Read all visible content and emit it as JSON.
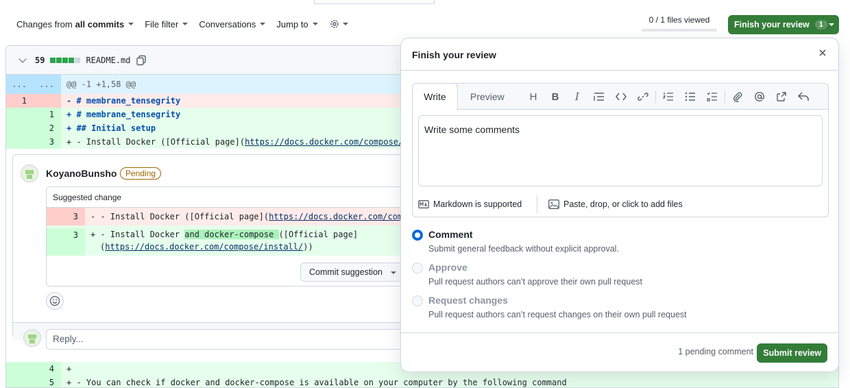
{
  "toolbar": {
    "changes_prefix": "Changes from",
    "changes_value": "all commits",
    "file_filter": "File filter",
    "conversations": "Conversations",
    "jump_to": "Jump to",
    "files_viewed": "0 / 1 files viewed",
    "finish_review": "Finish your review",
    "finish_count": "1"
  },
  "file": {
    "additions": "59",
    "name": "README.md",
    "hunk_header": "@@ -1 +1,58 @@",
    "hunk_old": "...",
    "hunk_new": "...",
    "lines": [
      {
        "old": "1",
        "new": "",
        "type": "del",
        "text": "- # membrane_tensegrity"
      },
      {
        "old": "",
        "new": "1",
        "type": "add",
        "text": "+ # membrane_tensegrity"
      },
      {
        "old": "",
        "new": "2",
        "type": "add",
        "text": "+ ## Initial setup"
      },
      {
        "old": "",
        "new": "3",
        "type": "add",
        "text_pre": "+ - Install Docker ([Official page](",
        "link": "https://docs.docker.com/compose/"
      }
    ],
    "lines_after": [
      {
        "old": "",
        "new": "4",
        "type": "add",
        "text": "+"
      },
      {
        "old": "",
        "new": "5",
        "type": "add",
        "text": "+ - You can check if docker and docker-compose is available on your computer by the following command"
      }
    ]
  },
  "thread": {
    "author": "KoyanoBunsho",
    "badge": "Pending",
    "suggestion_header": "Suggested change",
    "sugg_del_ln": "3",
    "sugg_del_pre": "- - Install Docker ([Official page](",
    "sugg_del_link": "https://docs.docker.com/compo",
    "sugg_add_ln": "3",
    "sugg_add_pre": "+ - Install Docker ",
    "sugg_add_hl": "and docker-compose ",
    "sugg_add_post": "([Official page]",
    "sugg_add_line2_pre": "(",
    "sugg_add_line2_link": "https://docs.docker.com/compose/install/",
    "sugg_add_line2_post": "))",
    "commit_suggestion": "Commit suggestion",
    "reply_placeholder": "Reply..."
  },
  "popover": {
    "title": "Finish your review",
    "tab_write": "Write",
    "tab_preview": "Preview",
    "comment_text": "Write some comments",
    "markdown_note": "Markdown is supported",
    "files_note": "Paste, drop, or click to add files",
    "options": [
      {
        "label": "Comment",
        "desc": "Submit general feedback without explicit approval."
      },
      {
        "label": "Approve",
        "desc": "Pull request authors can’t approve their own pull request"
      },
      {
        "label": "Request changes",
        "desc": "Pull request authors can’t request changes on their own pull request"
      }
    ],
    "pending_count": "1 pending comment",
    "submit": "Submit review"
  },
  "colors": {
    "accent_green": "#347d39",
    "radio_blue": "#0969da",
    "pending_badge": "#9a6700"
  },
  "icons": [
    "chevron-down-icon",
    "gear-icon",
    "copy-icon",
    "close-icon",
    "heading-icon",
    "bold-icon",
    "italic-icon",
    "quote-icon",
    "code-icon",
    "link-icon",
    "ordered-list-icon",
    "unordered-list-icon",
    "task-list-icon",
    "attach-icon",
    "mention-icon",
    "cross-reference-icon",
    "reply-icon",
    "markdown-icon",
    "image-icon",
    "smiley-icon"
  ]
}
